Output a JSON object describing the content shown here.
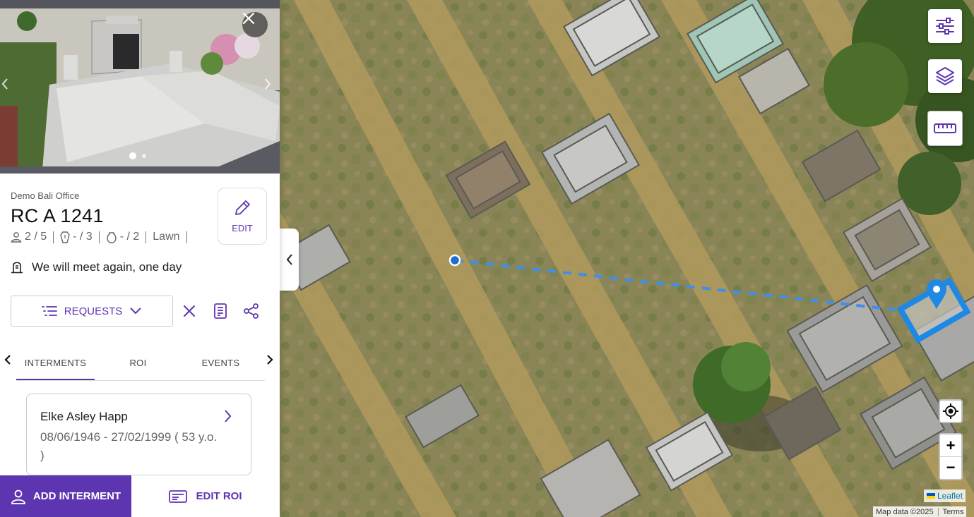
{
  "gallery": {
    "close_icon": "close-icon",
    "prev_icon": "chevron-left-icon",
    "next_icon": "chevron-right-icon",
    "slide_count": 2,
    "active_slide": 1
  },
  "plot": {
    "office": "Demo Bali Office",
    "title": "RC A 1241",
    "meta": {
      "people": "2 / 5",
      "pins": "- / 3",
      "urns": "- / 2",
      "type": "Lawn"
    },
    "edit_label": "EDIT",
    "epitaph": "We will meet again, one day"
  },
  "actions": {
    "requests_label": "REQUESTS",
    "icons": [
      "close-icon",
      "document-icon",
      "share-icon"
    ]
  },
  "tabs": [
    {
      "label": "INTERMENTS",
      "active": true
    },
    {
      "label": "ROI",
      "active": false
    },
    {
      "label": "EVENTS",
      "active": false
    }
  ],
  "interment": {
    "name": "Elke Asley Happ",
    "dates": "08/06/1946 - 27/02/1999 ( 53 y.o. )"
  },
  "bottom": {
    "add_label": "ADD INTERMENT",
    "edit_roi_label": "EDIT ROI"
  },
  "map": {
    "controls": [
      "filter-sliders-icon",
      "layers-icon",
      "ruler-icon",
      "locate-icon"
    ],
    "zoom_in": "+",
    "zoom_out": "−",
    "attribution_leaflet": "Leaflet",
    "attribution_data": "Map data ©2025",
    "terms": "Terms",
    "accent": "#1e88e5"
  },
  "colors": {
    "primary": "#5e35b1"
  }
}
